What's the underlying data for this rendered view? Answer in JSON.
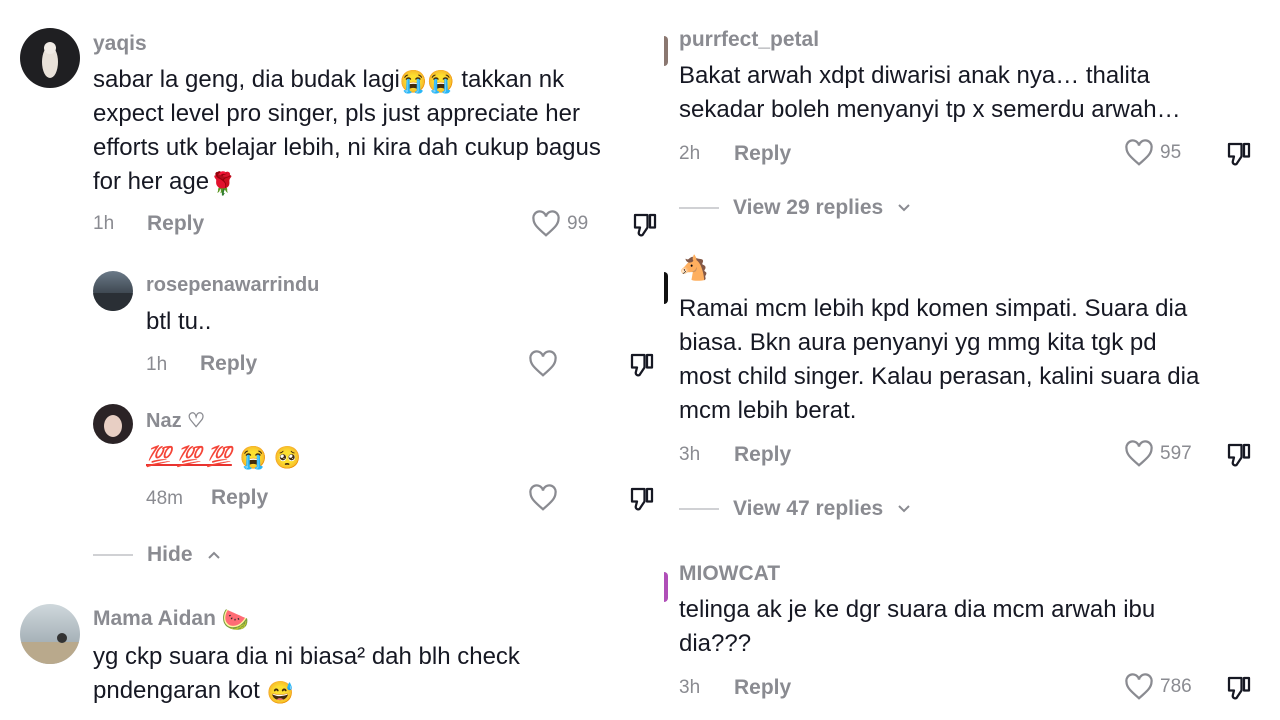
{
  "left": {
    "comments": [
      {
        "username": "yaqis",
        "text_lines": [
          "sabar la geng, dia budak lagi",
          "takkan nk",
          "expect level pro singer, pls just appreciate her",
          "efforts utk belajar lebih, ni kira dah cukup bagus",
          "for her age"
        ],
        "time": "1h",
        "reply": "Reply",
        "likes": "99"
      },
      {
        "username": "rosepenawarrindu",
        "text": "btl tu..",
        "time": "1h",
        "reply": "Reply"
      },
      {
        "username": "Naz ♡",
        "emoji_text": "💯 💯 💯",
        "time": "48m",
        "reply": "Reply"
      },
      {
        "username": "Mama Aidan",
        "text_lines": [
          "yg ckp suara dia ni biasa² dah blh check",
          "pndengaran kot"
        ]
      }
    ],
    "hide_label": "Hide"
  },
  "right": {
    "comments": [
      {
        "username": "purrfect_petal",
        "text_lines": [
          "Bakat arwah xdpt diwarisi anak nya… thalita",
          "sekadar boleh menyanyi tp x semerdu arwah…"
        ],
        "time": "2h",
        "reply": "Reply",
        "likes": "95",
        "view_replies": "View 29 replies"
      },
      {
        "username": "",
        "text_lines": [
          "Ramai mcm lebih kpd komen simpati. Suara dia",
          "biasa. Bkn aura penyanyi yg mmg kita tgk pd",
          "most child singer. Kalau perasan, kalini suara dia",
          "mcm lebih berat."
        ],
        "time": "3h",
        "reply": "Reply",
        "likes": "597",
        "view_replies": "View 47 replies"
      },
      {
        "username": "MIOWCAT",
        "text_lines": [
          "telinga ak je ke dgr suara dia mcm arwah ibu",
          "dia???"
        ],
        "time": "3h",
        "reply": "Reply",
        "likes": "786"
      }
    ]
  },
  "colors": {
    "text": "#161823",
    "muted": "#8a8b91",
    "divider": "#d0d1d4"
  },
  "icons": [
    "heart-icon",
    "dislike-icon",
    "chevron-down-icon",
    "chevron-up-icon"
  ]
}
